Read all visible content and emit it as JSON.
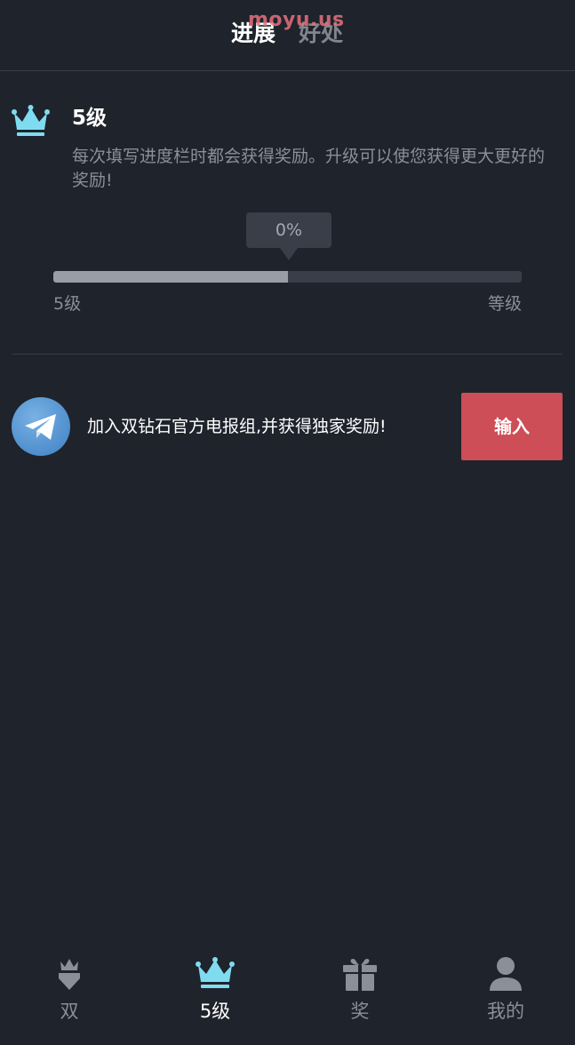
{
  "header": {
    "tabs": [
      {
        "label": "进展",
        "active": true
      },
      {
        "label": "好处",
        "active": false
      }
    ],
    "watermark": "moyu.us"
  },
  "level": {
    "icon": "crown-icon",
    "title": "5级",
    "description": "每次填写进度栏时都会获得奖励。升级可以使您获得更大更好的奖励!"
  },
  "progress": {
    "percent_label": "0%",
    "fill_fraction": 0.5,
    "left_label": "5级",
    "right_label": "等级"
  },
  "telegram": {
    "icon": "telegram-icon",
    "text": "加入双钻石官方电报组,并获得独家奖励!",
    "button_label": "输入"
  },
  "bottom_nav": {
    "items": [
      {
        "label": "双",
        "icon": "diamond-crown-icon",
        "active": false
      },
      {
        "label": "5级",
        "icon": "crown-icon",
        "active": true
      },
      {
        "label": "奖",
        "icon": "gift-icon",
        "active": false
      },
      {
        "label": "我的",
        "icon": "user-icon",
        "active": false
      }
    ]
  },
  "colors": {
    "background": "#1f232b",
    "accent_cyan": "#7fdcf0",
    "button_red": "#cd4e57",
    "muted_text": "#8a8f98"
  }
}
